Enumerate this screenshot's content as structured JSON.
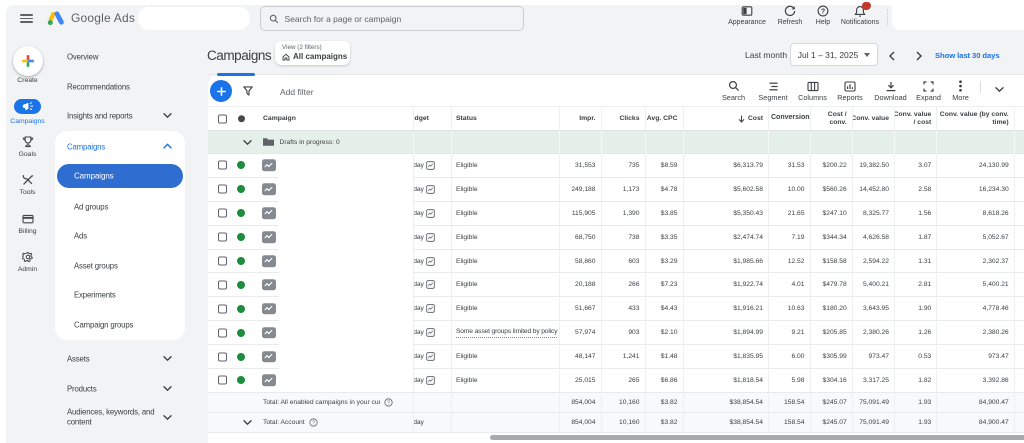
{
  "header": {
    "logo_text": "Google Ads",
    "search": {
      "placeholder": "Search for a page or campaign"
    },
    "actions": [
      {
        "label": "Appearance",
        "icon": "appearance-icon"
      },
      {
        "label": "Refresh",
        "icon": "refresh-icon"
      },
      {
        "label": "Help",
        "icon": "help-icon"
      },
      {
        "label": "Notifications",
        "icon": "notifications-icon",
        "badge": true
      }
    ]
  },
  "rail": {
    "items": [
      {
        "label": "Create",
        "icon": "plus-create-icon",
        "active": false
      },
      {
        "label": "Campaigns",
        "icon": "megaphone-icon",
        "active": true
      },
      {
        "label": "Goals",
        "icon": "trophy-icon",
        "active": false
      },
      {
        "label": "Tools",
        "icon": "tools-icon",
        "active": false
      },
      {
        "label": "Billing",
        "icon": "billing-icon",
        "active": false
      },
      {
        "label": "Admin",
        "icon": "gear-icon",
        "active": false
      }
    ]
  },
  "nav": {
    "top_items": [
      {
        "label": "Overview",
        "chevron": false
      },
      {
        "label": "Recommendations",
        "chevron": false
      },
      {
        "label": "Insights and reports",
        "chevron": true
      }
    ],
    "section": {
      "label": "Campaigns",
      "items": [
        {
          "label": "Campaigns",
          "selected": true
        },
        {
          "label": "Ad groups",
          "selected": false
        },
        {
          "label": "Ads",
          "selected": false
        },
        {
          "label": "Asset groups",
          "selected": false
        },
        {
          "label": "Experiments",
          "selected": false
        },
        {
          "label": "Campaign groups",
          "selected": false
        }
      ]
    },
    "bottom_items": [
      {
        "label": "Assets",
        "chevron": true
      },
      {
        "label": "Products",
        "chevron": true
      },
      {
        "label": "Audiences, keywords, and content",
        "chevron": true,
        "two_line": [
          "Audiences, keywords, and",
          "content"
        ]
      }
    ]
  },
  "page": {
    "title": "Campaigns",
    "view_chip": {
      "caption": "View (2 filters)",
      "label": "All campaigns"
    },
    "date_bar": {
      "preset": "Last month",
      "range": "Jul 1 – 31, 2025",
      "quick_link": "Show last 30 days"
    }
  },
  "toolbar": {
    "add_filter": "Add filter",
    "actions": [
      {
        "label": "Search",
        "icon": "search-icon"
      },
      {
        "label": "Segment",
        "icon": "segment-icon"
      },
      {
        "label": "Columns",
        "icon": "columns-icon"
      },
      {
        "label": "Reports",
        "icon": "reports-icon"
      },
      {
        "label": "Download",
        "icon": "download-icon"
      },
      {
        "label": "Expand",
        "icon": "expand-icon"
      },
      {
        "label": "More",
        "icon": "more-icon"
      }
    ]
  },
  "table": {
    "columns": [
      "Campaign",
      "Budget",
      "Status",
      "Impr.",
      "Clicks",
      "Avg. CPC",
      "Cost",
      "Conversions",
      "Cost / conv.",
      "Conv. value",
      "Conv. value / cost",
      "Conv. value (by conv. time)"
    ],
    "sort_column": "Cost",
    "drafts_row": {
      "label": "Drafts in progress: 0"
    },
    "rows": [
      {
        "status": "Eligible",
        "budget": "/day",
        "impr": "31,553",
        "clicks": "735",
        "avg_cpc": "$8.59",
        "cost": "$6,313.79",
        "conversions": "31.53",
        "cost_per_conv": "$200.22",
        "conv_value": "19,382.50",
        "conv_value_per_cost": "3.07",
        "conv_value_time": "24,130.99"
      },
      {
        "status": "Eligible",
        "budget": "/day",
        "impr": "249,188",
        "clicks": "1,173",
        "avg_cpc": "$4.78",
        "cost": "$5,602.58",
        "conversions": "10.00",
        "cost_per_conv": "$560.26",
        "conv_value": "14,452.80",
        "conv_value_per_cost": "2.58",
        "conv_value_time": "16,234.30"
      },
      {
        "status": "Eligible",
        "budget": "/day",
        "impr": "115,905",
        "clicks": "1,390",
        "avg_cpc": "$3.85",
        "cost": "$5,350.43",
        "conversions": "21.65",
        "cost_per_conv": "$247.10",
        "conv_value": "8,325.77",
        "conv_value_per_cost": "1.56",
        "conv_value_time": "8,618.26"
      },
      {
        "status": "Eligible",
        "budget": "/day",
        "impr": "68,750",
        "clicks": "738",
        "avg_cpc": "$3.35",
        "cost": "$2,474.74",
        "conversions": "7.19",
        "cost_per_conv": "$344.34",
        "conv_value": "4,626.58",
        "conv_value_per_cost": "1.87",
        "conv_value_time": "5,052.67"
      },
      {
        "status": "Eligible",
        "budget": "/day",
        "impr": "58,860",
        "clicks": "603",
        "avg_cpc": "$3.29",
        "cost": "$1,985.66",
        "conversions": "12.52",
        "cost_per_conv": "$158.58",
        "conv_value": "2,594.22",
        "conv_value_per_cost": "1.31",
        "conv_value_time": "2,302.37"
      },
      {
        "status": "Eligible",
        "budget": "/day",
        "impr": "20,188",
        "clicks": "266",
        "avg_cpc": "$7.23",
        "cost": "$1,922.74",
        "conversions": "4.01",
        "cost_per_conv": "$479.78",
        "conv_value": "5,400.21",
        "conv_value_per_cost": "2.81",
        "conv_value_time": "5,400.21"
      },
      {
        "status": "Eligible",
        "budget": "/day",
        "impr": "51,667",
        "clicks": "433",
        "avg_cpc": "$4.43",
        "cost": "$1,916.21",
        "conversions": "10.63",
        "cost_per_conv": "$180.20",
        "conv_value": "3,643.95",
        "conv_value_per_cost": "1.90",
        "conv_value_time": "4,778.46"
      },
      {
        "status": "Some asset groups limited by policy",
        "status_underline": true,
        "budget": "/day",
        "impr": "57,974",
        "clicks": "903",
        "avg_cpc": "$2.10",
        "cost": "$1,894.99",
        "conversions": "9.21",
        "cost_per_conv": "$205.85",
        "conv_value": "2,380.26",
        "conv_value_per_cost": "1.26",
        "conv_value_time": "2,380.26"
      },
      {
        "status": "Eligible",
        "budget": "/day",
        "impr": "48,147",
        "clicks": "1,241",
        "avg_cpc": "$1.48",
        "cost": "$1,835.95",
        "conversions": "6.00",
        "cost_per_conv": "$305.99",
        "conv_value": "973.47",
        "conv_value_per_cost": "0.53",
        "conv_value_time": "973.47"
      },
      {
        "status": "Eligible",
        "budget": "/day",
        "impr": "25,015",
        "clicks": "265",
        "avg_cpc": "$6.86",
        "cost": "$1,818.54",
        "conversions": "5.98",
        "cost_per_conv": "$304.16",
        "conv_value": "3,317.25",
        "conv_value_per_cost": "1.82",
        "conv_value_time": "3,392.86"
      }
    ],
    "totals": [
      {
        "label": "Total: All enabled campaigns in your cur…",
        "chevron": false,
        "budget": "",
        "impr": "854,004",
        "clicks": "10,160",
        "avg_cpc": "$3.82",
        "cost": "$38,854.54",
        "conversions": "158.54",
        "cost_per_conv": "$245.07",
        "conv_value": "75,091.49",
        "conv_value_per_cost": "1.93",
        "conv_value_time": "84,900.47"
      },
      {
        "label": "Total: Account",
        "chevron": true,
        "budget": "/day",
        "impr": "854,004",
        "clicks": "10,160",
        "avg_cpc": "$3.82",
        "cost": "$38,854.54",
        "conversions": "158.54",
        "cost_per_conv": "$245.07",
        "conv_value": "75,091.49",
        "conv_value_per_cost": "1.93",
        "conv_value_time": "84,900.47"
      }
    ]
  },
  "colors": {
    "accent": "#1a73e8",
    "enabled_green": "#1e8e3e",
    "drafts_row_bg": "#e6f0ea",
    "header_bg": "#f1f3f4",
    "badge_red": "#c5221f",
    "total_row_bg": "#f8f9fa"
  }
}
